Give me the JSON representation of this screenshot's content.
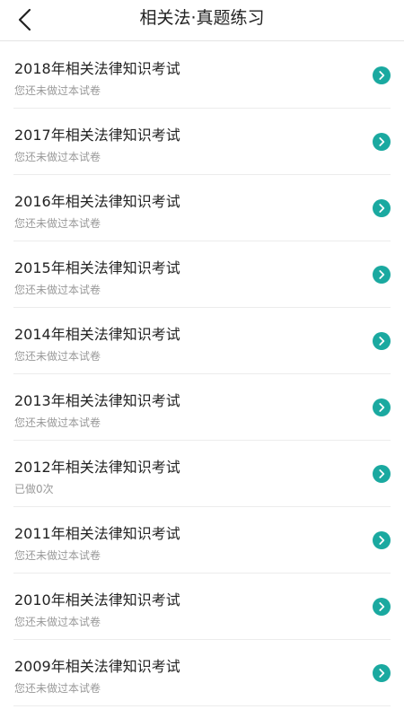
{
  "header": {
    "title": "相关法·真题练习",
    "back_icon": "chevron-left-icon"
  },
  "colors": {
    "accent": "#1aa9a0",
    "title_text": "#222222",
    "status_text": "#999999",
    "divider": "#ececec"
  },
  "exams": [
    {
      "title": "2018年相关法律知识考试",
      "status": "您还未做过本试卷"
    },
    {
      "title": "2017年相关法律知识考试",
      "status": "您还未做过本试卷"
    },
    {
      "title": "2016年相关法律知识考试",
      "status": "您还未做过本试卷"
    },
    {
      "title": "2015年相关法律知识考试",
      "status": "您还未做过本试卷"
    },
    {
      "title": "2014年相关法律知识考试",
      "status": "您还未做过本试卷"
    },
    {
      "title": "2013年相关法律知识考试",
      "status": "您还未做过本试卷"
    },
    {
      "title": "2012年相关法律知识考试",
      "status": "已做0次"
    },
    {
      "title": "2011年相关法律知识考试",
      "status": "您还未做过本试卷"
    },
    {
      "title": "2010年相关法律知识考试",
      "status": "您还未做过本试卷"
    },
    {
      "title": "2009年相关法律知识考试",
      "status": "您还未做过本试卷"
    }
  ]
}
